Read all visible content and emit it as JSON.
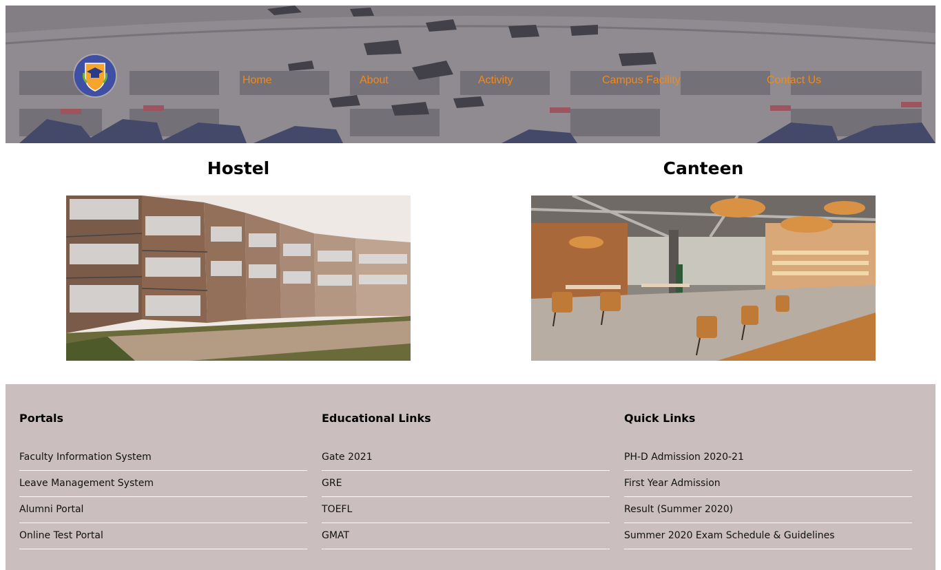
{
  "header": {
    "nav": [
      {
        "label": "Home"
      },
      {
        "label": "About"
      },
      {
        "label": "Activity"
      },
      {
        "label": "Campus Facility"
      },
      {
        "label": "Contact Us"
      }
    ],
    "nav_color": "#f08a1c",
    "logo_icon": "graduation-cap-shield-icon"
  },
  "facilities": [
    {
      "title": "Hostel",
      "image": "hostel-building-photo"
    },
    {
      "title": "Canteen",
      "image": "canteen-interior-photo"
    }
  ],
  "footer": {
    "background": "#cbbebe",
    "columns": [
      {
        "heading": "Portals",
        "items": [
          "Faculty Information System",
          "Leave Management System",
          "Alumni Portal",
          "Online Test Portal"
        ]
      },
      {
        "heading": "Educational Links",
        "items": [
          "Gate 2021",
          "GRE",
          "TOEFL",
          "GMAT"
        ]
      },
      {
        "heading": "Quick Links",
        "items": [
          "PH-D Admission 2020-21",
          "First Year Admission",
          "Result (Summer 2020)",
          "Summer 2020 Exam Schedule & Guidelines"
        ]
      }
    ]
  }
}
